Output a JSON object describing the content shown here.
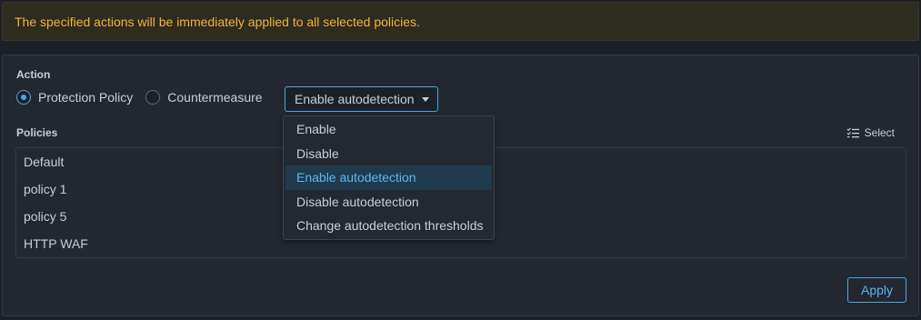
{
  "warning": {
    "text": "The specified actions will be immediately applied to all selected policies."
  },
  "action": {
    "label": "Action",
    "options": [
      {
        "label": "Protection Policy",
        "checked": true
      },
      {
        "label": "Countermeasure",
        "checked": false
      }
    ],
    "dropdown": {
      "selected": "Enable autodetection",
      "items": [
        "Enable",
        "Disable",
        "Enable autodetection",
        "Disable autodetection",
        "Change autodetection thresholds"
      ]
    }
  },
  "policies": {
    "label": "Policies",
    "select_label": "Select",
    "items": [
      "Default",
      "policy 1",
      "policy 5",
      "HTTP WAF"
    ]
  },
  "apply_label": "Apply",
  "colors": {
    "accent": "#4aa8e0",
    "warning": "#f0b43c"
  }
}
